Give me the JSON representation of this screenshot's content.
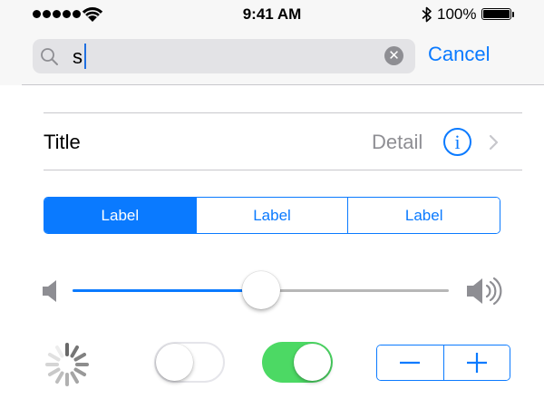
{
  "status_bar": {
    "time": "9:41 AM",
    "battery_text": "100%",
    "signal_bars": 5,
    "battery_level": 1.0,
    "icons": [
      "wifi-icon",
      "bluetooth-icon",
      "battery-icon"
    ]
  },
  "search": {
    "value": "s",
    "cancel_label": "Cancel",
    "icons": [
      "search-icon",
      "clear-icon"
    ]
  },
  "row": {
    "title": "Title",
    "detail": "Detail",
    "info_glyph": "i",
    "icons": [
      "info-icon",
      "chevron-right-icon"
    ]
  },
  "segmented": {
    "segments": [
      "Label",
      "Label",
      "Label"
    ],
    "selected_index": 0
  },
  "slider": {
    "value": 0.5,
    "icons": [
      "volume-low-icon",
      "volume-high-icon"
    ]
  },
  "activity_indicator": {
    "animating": true
  },
  "switches": [
    {
      "on": false
    },
    {
      "on": true
    }
  ],
  "stepper": {
    "icons": [
      "minus-icon",
      "plus-icon"
    ]
  },
  "colors": {
    "accent": "#0a7aff",
    "switch_on": "#4cd964",
    "secondary_text": "#8e8e93",
    "separator": "#c8c7cc",
    "bar_background": "#f7f7f7",
    "search_field": "#e3e3e6"
  }
}
